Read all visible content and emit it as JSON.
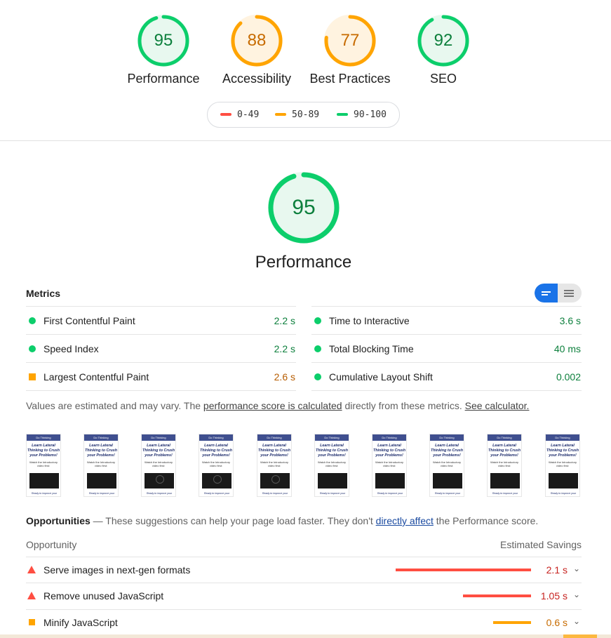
{
  "summary": {
    "gauges": [
      {
        "score": "95",
        "label": "Performance",
        "fraction": 0.95,
        "color": "#0cce6b",
        "fill": "#e8f8ef",
        "text": "#0c7f3c"
      },
      {
        "score": "88",
        "label": "Accessibility",
        "fraction": 0.88,
        "color": "#ffa400",
        "fill": "#fff3e0",
        "text": "#c76b00"
      },
      {
        "score": "77",
        "label": "Best Practices",
        "fraction": 0.77,
        "color": "#ffa400",
        "fill": "#fff3e0",
        "text": "#c76b00"
      },
      {
        "score": "92",
        "label": "SEO",
        "fraction": 0.92,
        "color": "#0cce6b",
        "fill": "#e8f8ef",
        "text": "#0c7f3c"
      }
    ],
    "legend": [
      {
        "range": "0-49",
        "color": "#ff4e42"
      },
      {
        "range": "50-89",
        "color": "#ffa400"
      },
      {
        "range": "90-100",
        "color": "#0cce6b"
      }
    ]
  },
  "performance": {
    "score": "95",
    "fraction": 0.95,
    "title": "Performance",
    "metrics_heading": "Metrics",
    "metrics": [
      {
        "title": "First Contentful Paint",
        "value": "2.2 s",
        "status": "pass"
      },
      {
        "title": "Time to Interactive",
        "value": "3.6 s",
        "status": "pass"
      },
      {
        "title": "Speed Index",
        "value": "2.2 s",
        "status": "pass"
      },
      {
        "title": "Total Blocking Time",
        "value": "40 ms",
        "status": "pass"
      },
      {
        "title": "Largest Contentful Paint",
        "value": "2.6 s",
        "status": "average"
      },
      {
        "title": "Cumulative Layout Shift",
        "value": "0.002",
        "status": "pass"
      }
    ],
    "note": {
      "prefix": "Values are estimated and may vary. The ",
      "link1": "performance score is calculated",
      "middle": " directly from these metrics. ",
      "link2": "See calculator."
    },
    "filmstrip": {
      "frame_header": "Do Thinking",
      "frame_title": "Learn Lateral Thinking to Crush your Problems!",
      "frame_sub": "Watch the Introductory video first:",
      "frame_caption": "Ready to improve your",
      "frame_count": 10
    }
  },
  "opportunities": {
    "heading": "Opportunities",
    "desc_prefix": " — These suggestions can help your page load faster. They don't ",
    "desc_link": "directly affect",
    "desc_suffix": " the Performance score.",
    "col_opportunity": "Opportunity",
    "col_savings": "Estimated Savings",
    "items": [
      {
        "title": "Serve images in next-gen formats",
        "savings": "2.1 s",
        "fraction": 1.0,
        "severity": "fail",
        "color": "#ff4e42",
        "text_color": "#c7221f"
      },
      {
        "title": "Remove unused JavaScript",
        "savings": "1.05 s",
        "fraction": 0.5,
        "severity": "fail",
        "color": "#ff4e42",
        "text_color": "#c7221f"
      },
      {
        "title": "Minify JavaScript",
        "savings": "0.6 s",
        "fraction": 0.28,
        "severity": "average",
        "color": "#ffa400",
        "text_color": "#c76b00"
      }
    ]
  }
}
